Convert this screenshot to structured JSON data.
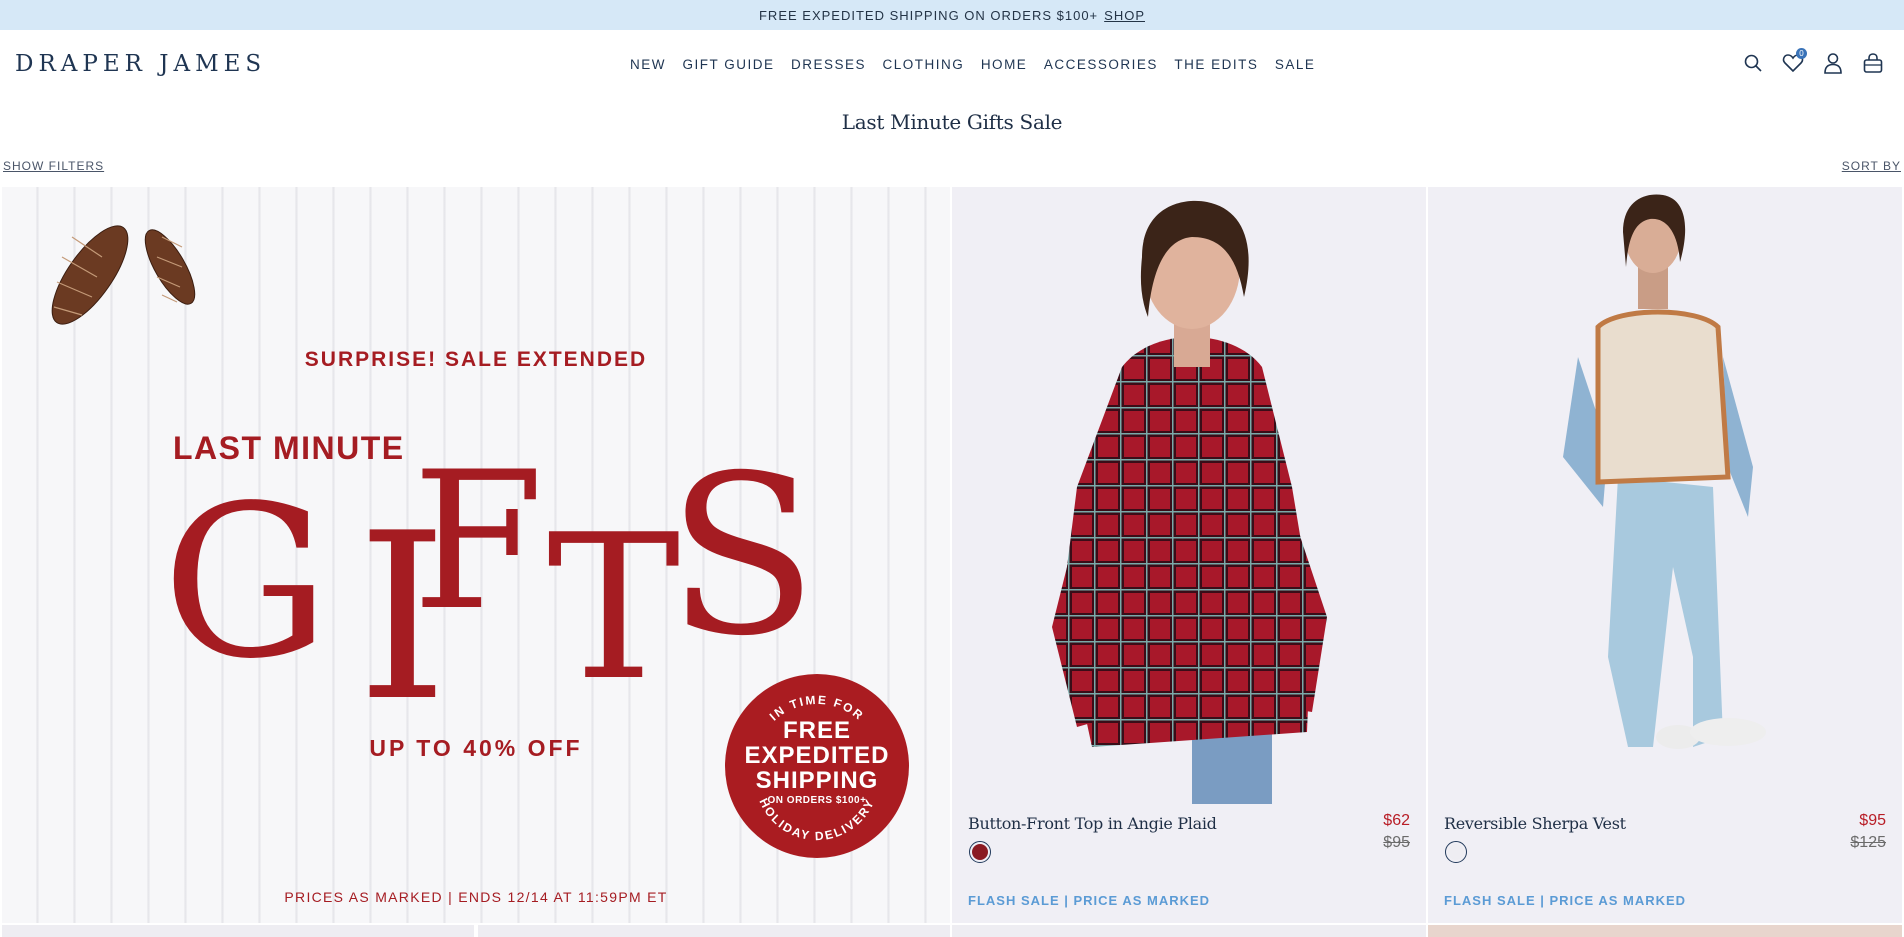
{
  "announcement": {
    "text": "FREE EXPEDITED SHIPPING ON ORDERS $100+",
    "link": "SHOP"
  },
  "header": {
    "logo": "DRAPER JAMES",
    "nav": [
      "NEW",
      "GIFT GUIDE",
      "DRESSES",
      "CLOTHING",
      "HOME",
      "ACCESSORIES",
      "THE EDITS",
      "SALE"
    ],
    "icons": [
      "search-icon",
      "heart-icon",
      "account-icon",
      "cart-icon"
    ],
    "wishlist_count": "0"
  },
  "page": {
    "title": "Last Minute Gifts Sale",
    "show_filters": "SHOW FILTERS",
    "sort_by": "SORT BY"
  },
  "promo": {
    "pre": "SURPRISE! SALE EXTENDED",
    "line1": "LAST MINUTE",
    "headline": "GIFTS",
    "offer": "UP TO 40% OFF",
    "footer": "PRICES AS MARKED | ENDS 12/14 AT 11:59PM ET",
    "seal_top": "IN TIME FOR",
    "seal_main": "FREE EXPEDITED SHIPPING",
    "seal_sub": "ON ORDERS $100+",
    "seal_bottom": "HOLIDAY DELIVERY",
    "accent_color": "#a51c22"
  },
  "products": [
    {
      "name": "Button-Front Top in Angie Plaid",
      "sale_price": "$62",
      "original_price": "$95",
      "tag": "FLASH SALE | PRICE AS MARKED",
      "swatch_color": "#8b1a22"
    },
    {
      "name": "Reversible Sherpa Vest",
      "sale_price": "$95",
      "original_price": "$125",
      "tag": "FLASH SALE | PRICE AS MARKED",
      "swatch_color": "#eeedf2"
    }
  ]
}
